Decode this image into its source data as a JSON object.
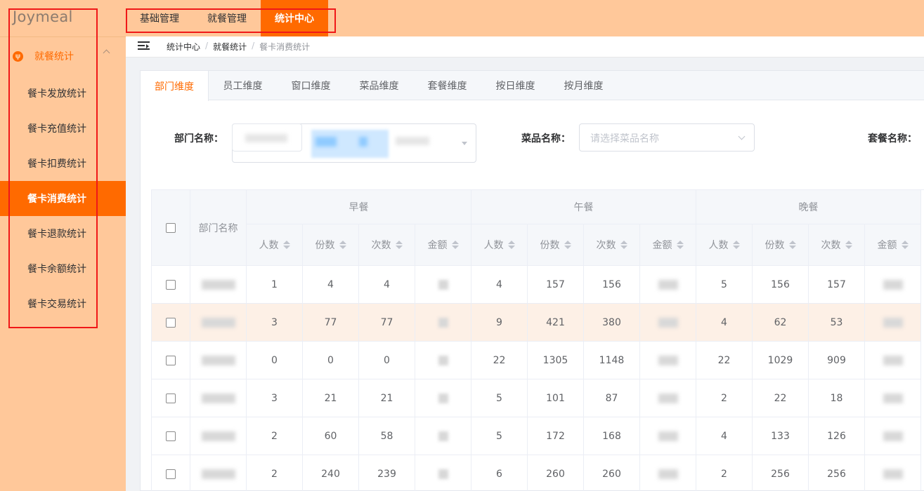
{
  "sidebar": {
    "logo": "Joymeal",
    "group": {
      "icon": "utensils-icon",
      "label": "就餐统计"
    },
    "items": [
      {
        "label": "餐卡发放统计",
        "active": false
      },
      {
        "label": "餐卡充值统计",
        "active": false
      },
      {
        "label": "餐卡扣费统计",
        "active": false
      },
      {
        "label": "餐卡消费统计",
        "active": true
      },
      {
        "label": "餐卡退款统计",
        "active": false
      },
      {
        "label": "餐卡余额统计",
        "active": false
      },
      {
        "label": "餐卡交易统计",
        "active": false
      }
    ]
  },
  "topnav": {
    "items": [
      {
        "label": "基础管理",
        "active": false
      },
      {
        "label": "就餐管理",
        "active": false
      },
      {
        "label": "统计中心",
        "active": true
      }
    ]
  },
  "breadcrumb": {
    "items": [
      "统计中心",
      "就餐统计",
      "餐卡消费统计"
    ]
  },
  "tabs": {
    "items": [
      {
        "label": "部门维度",
        "active": true
      },
      {
        "label": "员工维度",
        "active": false
      },
      {
        "label": "窗口维度",
        "active": false
      },
      {
        "label": "菜品维度",
        "active": false
      },
      {
        "label": "套餐维度",
        "active": false
      },
      {
        "label": "按日维度",
        "active": false
      },
      {
        "label": "按月维度",
        "active": false
      }
    ]
  },
  "filters": {
    "dept_label": "部门名称：",
    "dish_label": "菜品名称：",
    "dish_placeholder": "请选择菜品名称",
    "package_label": "套餐名称："
  },
  "table": {
    "dept_header": "部门名称",
    "groups": [
      "早餐",
      "午餐",
      "晚餐"
    ],
    "sub_headers": [
      "人数",
      "份数",
      "次数",
      "金额"
    ],
    "rows": [
      {
        "highlight": false,
        "values": [
          "1",
          "4",
          "4",
          "",
          "4",
          "157",
          "156",
          "",
          "5",
          "156",
          "157",
          ""
        ]
      },
      {
        "highlight": true,
        "values": [
          "3",
          "77",
          "77",
          "",
          "9",
          "421",
          "380",
          "",
          "4",
          "62",
          "53",
          ""
        ]
      },
      {
        "highlight": false,
        "values": [
          "0",
          "0",
          "0",
          "",
          "22",
          "1305",
          "1148",
          "",
          "22",
          "1029",
          "909",
          ""
        ]
      },
      {
        "highlight": false,
        "values": [
          "3",
          "21",
          "21",
          "",
          "5",
          "101",
          "87",
          "",
          "2",
          "22",
          "18",
          ""
        ]
      },
      {
        "highlight": false,
        "values": [
          "2",
          "60",
          "58",
          "",
          "5",
          "172",
          "168",
          "",
          "4",
          "133",
          "126",
          ""
        ]
      },
      {
        "highlight": false,
        "values": [
          "2",
          "240",
          "239",
          "",
          "6",
          "260",
          "260",
          "",
          "2",
          "256",
          "256",
          ""
        ]
      }
    ]
  }
}
